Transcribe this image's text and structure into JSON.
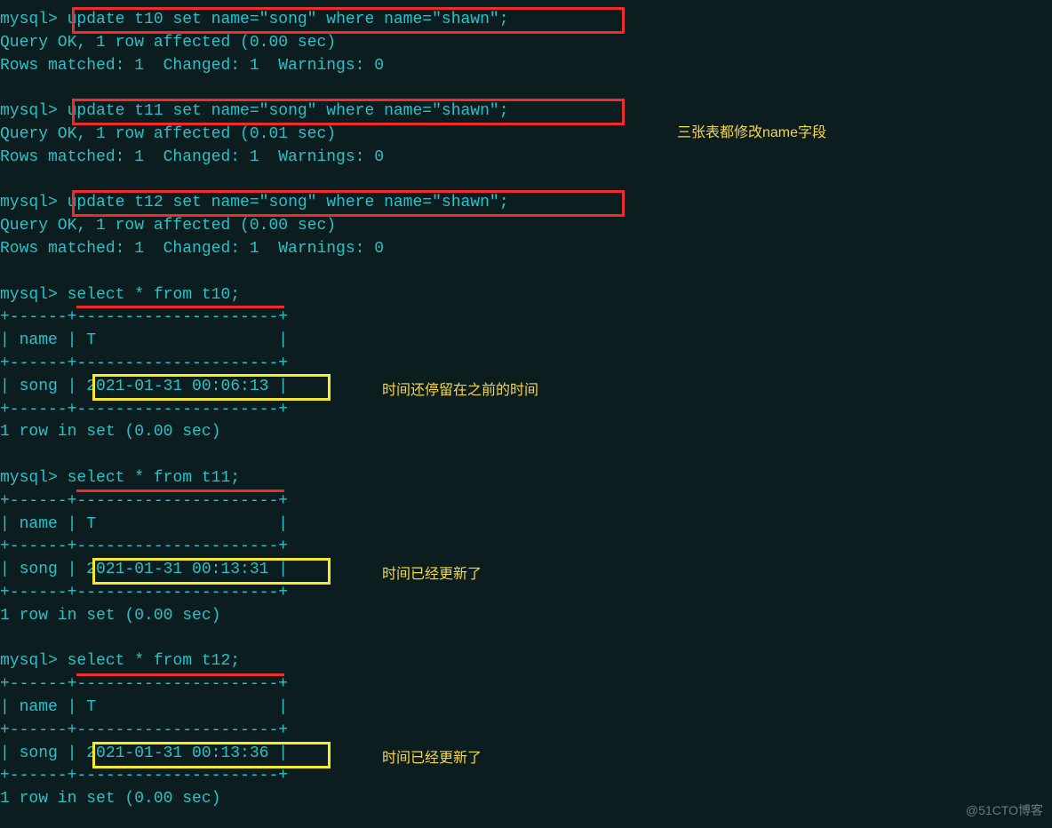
{
  "prompt": "mysql> ",
  "cmd": {
    "u1": "update t10 set name=\"song\" where name=\"shawn\";",
    "u2": "update t11 set name=\"song\" where name=\"shawn\";",
    "u3": "update t12 set name=\"song\" where name=\"shawn\";",
    "s1": "select * from t10;",
    "s2": "select * from t11;",
    "s3": "select * from t12;"
  },
  "resp": {
    "ok_0": "Query OK, 1 row affected (0.00 sec)",
    "ok_1": "Query OK, 1 row affected (0.01 sec)",
    "rw": "Rows matched: 1  Changed: 1  Warnings: 0",
    "set": "1 row in set (0.00 sec)"
  },
  "tbl": {
    "border": "+------+---------------------+",
    "header": "| name | T                   |",
    "r1": "| song | 2021-01-31 00:06:13 |",
    "r2": "| song | 2021-01-31 00:13:31 |",
    "r3": "| song | 2021-01-31 00:13:36 |"
  },
  "annot": {
    "a1": "三张表都修改name字段",
    "a2": "时间还停留在之前的时间",
    "a3": "时间已经更新了",
    "a4": "时间已经更新了"
  },
  "watermark": "@51CTO博客",
  "chart_data": {
    "type": "table",
    "tables": [
      {
        "name": "t10",
        "columns": [
          "name",
          "T"
        ],
        "rows": [
          [
            "song",
            "2021-01-31 00:06:13"
          ]
        ]
      },
      {
        "name": "t11",
        "columns": [
          "name",
          "T"
        ],
        "rows": [
          [
            "song",
            "2021-01-31 00:13:31"
          ]
        ]
      },
      {
        "name": "t12",
        "columns": [
          "name",
          "T"
        ],
        "rows": [
          [
            "song",
            "2021-01-31 00:13:36"
          ]
        ]
      }
    ]
  }
}
